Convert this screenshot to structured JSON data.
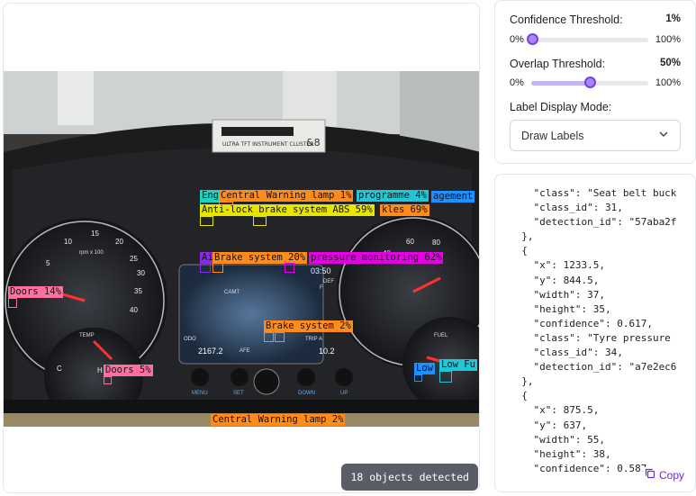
{
  "image_panel": {
    "objects_badge": "18 objects detected",
    "photo_texts": {
      "rpm_label": "rpm x 100",
      "temp_label": "TEMP",
      "fuel_label": "FUEL",
      "clock": "03:50",
      "display_top": "CAMT",
      "display_def": "DEF",
      "display_f": "F",
      "odo_label": "ODO",
      "odo_value": "2167.2",
      "afe_label": "AFE",
      "trip_label": "TRIP A",
      "trip_value": "10.2",
      "button_menu": "MENU",
      "button_set": "SET",
      "button_down": "DOWN",
      "button_up": "UP",
      "rpm_ticks": [
        "5",
        "10",
        "15",
        "20",
        "25",
        "30",
        "35",
        "40"
      ],
      "speed_ticks": [
        "40",
        "60",
        "80"
      ],
      "temp_c": "C",
      "temp_h": "H"
    },
    "detections": [
      {
        "label": "Eng",
        "color": "#1fd1c0"
      },
      {
        "label": "Central Warning lamp 1%",
        "color": "#ff8c1a"
      },
      {
        "label": "programme 4%",
        "color": "#20c7d6"
      },
      {
        "label": "agement",
        "color": "#1e90ff"
      },
      {
        "label": "Anti-lock brake system ABS 59%",
        "color": "#e6e600"
      },
      {
        "label": "kles 69%",
        "color": "#ff8c1a"
      },
      {
        "label": "Ai",
        "color": "#8a2be2"
      },
      {
        "label": "Brake system 20%",
        "color": "#ff8c1a"
      },
      {
        "label": "pressure monitoring 62%",
        "color": "#e600e6"
      },
      {
        "label": "Doors 14%",
        "color": "#ff6fa0"
      },
      {
        "label": "Brake system 2%",
        "color": "#ff8c1a"
      },
      {
        "label": "Doors 5%",
        "color": "#ff6fa0"
      },
      {
        "label": "Low",
        "color": "#1e90ff"
      },
      {
        "label": "Low Fu",
        "color": "#20c7d6"
      },
      {
        "label": "Central Warning lamp 2%",
        "color": "#ff8c1a"
      }
    ]
  },
  "controls": {
    "confidence": {
      "label": "Confidence Threshold:",
      "value": "1%",
      "min": "0%",
      "max": "100%",
      "fraction": 0.01
    },
    "overlap": {
      "label": "Overlap Threshold:",
      "value": "50%",
      "min": "0%",
      "max": "100%",
      "fraction": 0.5
    },
    "display_mode": {
      "label": "Label Display Mode:",
      "selected": "Draw Labels"
    }
  },
  "json_panel": {
    "lines": [
      "    \"class\": \"Seat belt buck",
      "    \"class_id\": 31,",
      "    \"detection_id\": \"57aba2f",
      "  },",
      "  {",
      "    \"x\": 1233.5,",
      "    \"y\": 844.5,",
      "    \"width\": 37,",
      "    \"height\": 35,",
      "    \"confidence\": 0.617,",
      "    \"class\": \"Tyre pressure",
      "    \"class_id\": 34,",
      "    \"detection_id\": \"a7e2ec6",
      "  },",
      "  {",
      "    \"x\": 875.5,",
      "    \"y\": 637,",
      "    \"width\": 55,",
      "    \"height\": 38,",
      "    \"confidence\": 0.587,"
    ],
    "copy_label": "Copy"
  }
}
